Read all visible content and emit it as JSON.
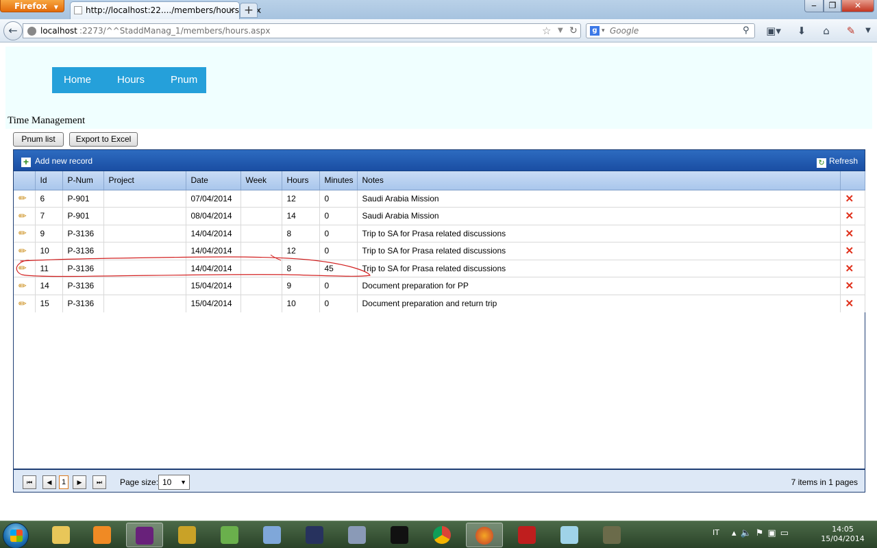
{
  "browser": {
    "menu_button": "Firefox",
    "tab_title": "http://localhost:22..../members/hours.aspx",
    "new_tab": "+",
    "url_host": "localhost",
    "url_rest": ":2273/^^StaddManag_1/members/hours.aspx",
    "search_placeholder": "Google"
  },
  "nav": {
    "items": [
      "Home",
      "Hours",
      "Pnum"
    ]
  },
  "page": {
    "title": "Time Management",
    "pnum_list_button": "Pnum list",
    "export_button": "Export to Excel"
  },
  "grid": {
    "add_record": "Add new record",
    "refresh": "Refresh",
    "columns": [
      "",
      "Id",
      "P-Num",
      "Project",
      "Date",
      "Week",
      "Hours",
      "Minutes",
      "Notes",
      ""
    ],
    "rows": [
      {
        "id": "6",
        "pnum": "P-901",
        "project": "",
        "date": "07/04/2014",
        "week": "",
        "hours": "12",
        "minutes": "0",
        "notes": "Saudi Arabia Mission"
      },
      {
        "id": "7",
        "pnum": "P-901",
        "project": "",
        "date": "08/04/2014",
        "week": "",
        "hours": "14",
        "minutes": "0",
        "notes": "Saudi Arabia Mission"
      },
      {
        "id": "9",
        "pnum": "P-3136",
        "project": "",
        "date": "14/04/2014",
        "week": "",
        "hours": "8",
        "minutes": "0",
        "notes": "Trip to SA for Prasa related discussions"
      },
      {
        "id": "10",
        "pnum": "P-3136",
        "project": "",
        "date": "14/04/2014",
        "week": "",
        "hours": "12",
        "minutes": "0",
        "notes": "Trip to SA for Prasa related discussions"
      },
      {
        "id": "11",
        "pnum": "P-3136",
        "project": "",
        "date": "14/04/2014",
        "week": "",
        "hours": "8",
        "minutes": "45",
        "notes": "Trip to SA for Prasa related discussions"
      },
      {
        "id": "14",
        "pnum": "P-3136",
        "project": "",
        "date": "15/04/2014",
        "week": "",
        "hours": "9",
        "minutes": "0",
        "notes": "Document preparation for PP"
      },
      {
        "id": "15",
        "pnum": "P-3136",
        "project": "",
        "date": "15/04/2014",
        "week": "",
        "hours": "10",
        "minutes": "0",
        "notes": "Document preparation and return trip"
      }
    ],
    "pager": {
      "current_page": "1",
      "page_size_label": "Page size:",
      "page_size": "10",
      "info": "7 items in 1 pages"
    }
  },
  "taskbar": {
    "language": "IT",
    "time": "14:05",
    "date": "15/04/2014"
  },
  "colors": {
    "nav_bg": "#25a0da",
    "header_band": "#f0ffff",
    "grid_toolbar": "#1a4ea3",
    "annotation_red": "#d22020"
  }
}
